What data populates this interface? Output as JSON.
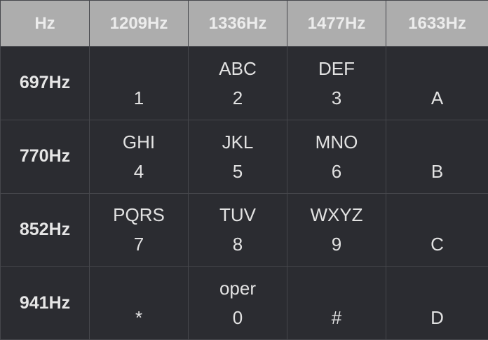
{
  "header": [
    "Hz",
    "1209Hz",
    "1336Hz",
    "1477Hz",
    "1633Hz"
  ],
  "rows": [
    {
      "label": "697Hz",
      "keys": [
        {
          "letters": "",
          "digit": "1"
        },
        {
          "letters": "ABC",
          "digit": "2"
        },
        {
          "letters": "DEF",
          "digit": "3"
        },
        {
          "letters": "",
          "digit": "A"
        }
      ]
    },
    {
      "label": "770Hz",
      "keys": [
        {
          "letters": "GHI",
          "digit": "4"
        },
        {
          "letters": "JKL",
          "digit": "5"
        },
        {
          "letters": "MNO",
          "digit": "6"
        },
        {
          "letters": "",
          "digit": "B"
        }
      ]
    },
    {
      "label": "852Hz",
      "keys": [
        {
          "letters": "PQRS",
          "digit": "7"
        },
        {
          "letters": "TUV",
          "digit": "8"
        },
        {
          "letters": "WXYZ",
          "digit": "9"
        },
        {
          "letters": "",
          "digit": "C"
        }
      ]
    },
    {
      "label": "941Hz",
      "keys": [
        {
          "letters": "",
          "digit": "*"
        },
        {
          "letters": "oper",
          "digit": "0"
        },
        {
          "letters": "",
          "digit": "#"
        },
        {
          "letters": "",
          "digit": "D"
        }
      ]
    }
  ]
}
